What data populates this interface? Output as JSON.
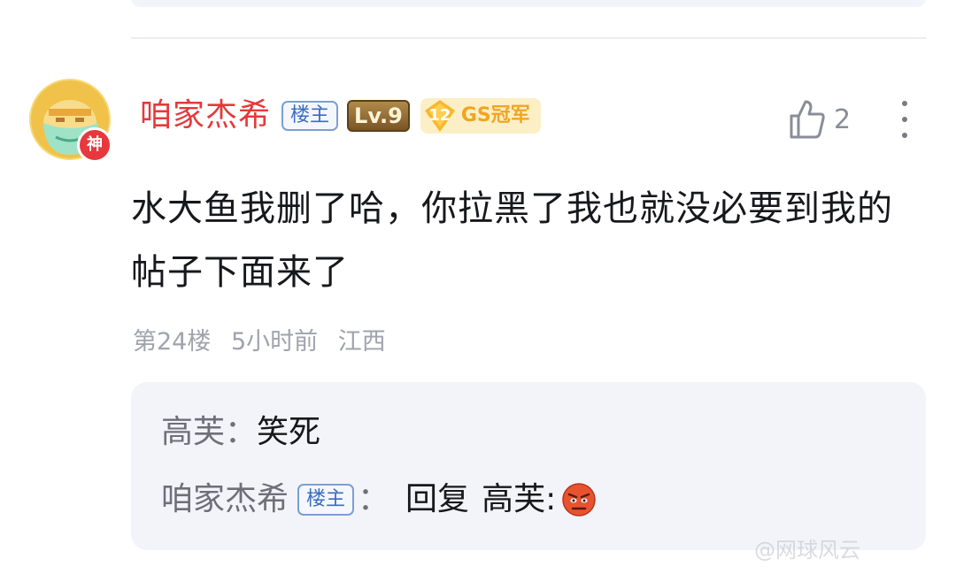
{
  "post": {
    "author": "咱家杰希",
    "owner_tag": "楼主",
    "level": "Lv.9",
    "champion_number": "12",
    "champion_label": "GS冠军",
    "avatar_badge": "神",
    "likes": "2",
    "content": "水大鱼我删了哈，你拉黑了我也就没必要到我的帖子下面来了",
    "floor": "第24楼",
    "time": "5小时前",
    "location": "江西"
  },
  "replies": [
    {
      "author": "高芙",
      "separator": "：",
      "text": "笑死"
    },
    {
      "author": "咱家杰希",
      "owner_tag": "楼主",
      "separator": "：",
      "reply_word": "回复",
      "reply_to": "高芙",
      "reply_sep": " :",
      "emoji": "angry-face-emoji"
    }
  ],
  "watermark": "@网球风云",
  "colors": {
    "username": "#e4393c",
    "owner_tag": "#3c6cc0",
    "reply_bg": "#f3f4f9",
    "meta": "#a0a3ad",
    "champion": "#f0a522"
  },
  "icons": {
    "like": "thumbs-up-icon",
    "more": "more-vertical-icon"
  }
}
